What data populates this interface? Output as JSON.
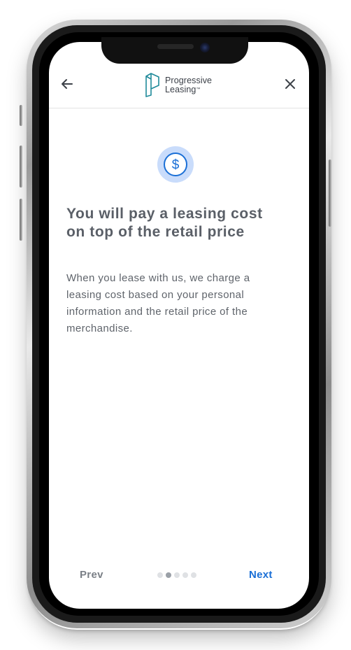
{
  "header": {
    "brand_line1": "Progressive",
    "brand_line2": "Leasing",
    "brand_tm": "™"
  },
  "content": {
    "icon": "dollar-circle-icon",
    "heading": "You will pay a leasing cost on top of the retail price",
    "body": "When you lease with us, we charge a leasing cost based on your personal information and the retail price of the merchandise."
  },
  "footer": {
    "prev_label": "Prev",
    "next_label": "Next",
    "pagination": {
      "total": 5,
      "current": 2
    }
  },
  "colors": {
    "accent": "#1a6fd6",
    "icon_bg": "#c9dcfb",
    "heading": "#5a5f67",
    "body": "#5f646b",
    "logo_mark": "#1f8a9a"
  }
}
